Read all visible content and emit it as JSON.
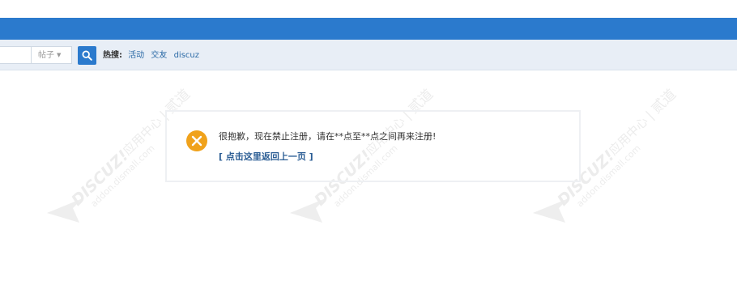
{
  "search": {
    "input_placeholder": "",
    "type_label": "帖子",
    "hot_label": "热搜:",
    "hot_tags": [
      "活动",
      "交友",
      "discuz"
    ]
  },
  "message": {
    "text": "很抱歉，现在禁止注册，请在**点至**点之间再来注册!",
    "back_link": "[ 点击这里返回上一页 ]"
  },
  "watermark": {
    "brand": "DISCUZ!应用中心",
    "brand_cn": "贰道",
    "url": "addon.dismall.com"
  },
  "colors": {
    "nav": "#2b7acd",
    "searchbar": "#e8eef6",
    "error_icon": "#f0a21b",
    "link": "#2b5d94"
  }
}
